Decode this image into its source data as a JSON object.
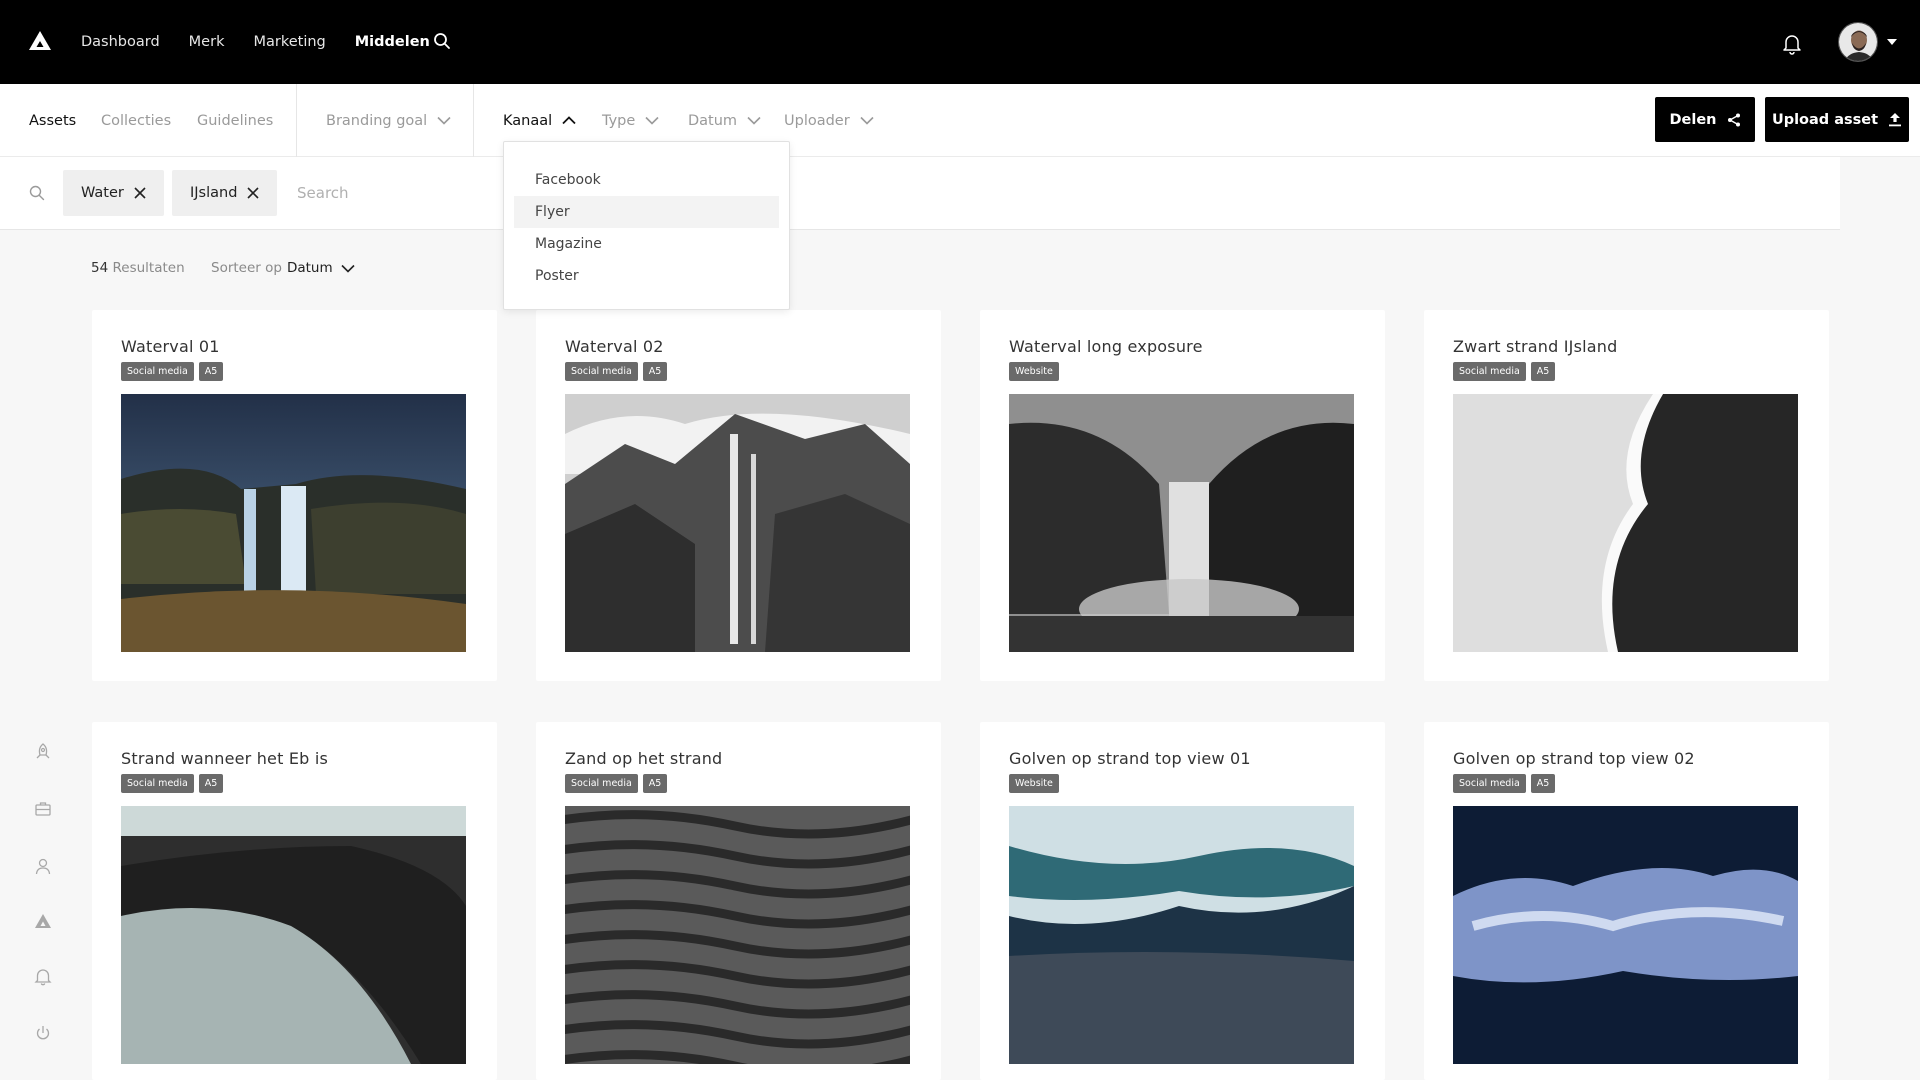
{
  "nav": {
    "items": [
      {
        "label": "Dashboard",
        "active": false
      },
      {
        "label": "Merk",
        "active": false
      },
      {
        "label": "Marketing",
        "active": false
      },
      {
        "label": "Middelen",
        "active": true
      }
    ]
  },
  "toolbar": {
    "tabs": [
      "Assets",
      "Collecties",
      "Guidelines"
    ],
    "filters": {
      "branding_goal": "Branding goal",
      "kanaal": "Kanaal",
      "type": "Type",
      "datum": "Datum",
      "uploader": "Uploader"
    },
    "share_label": "Delen",
    "upload_label": "Upload asset"
  },
  "search": {
    "chips": [
      "Water",
      "IJsland"
    ],
    "placeholder": "Search"
  },
  "kanaal_dropdown": {
    "options": [
      "Facebook",
      "Flyer",
      "Magazine",
      "Poster"
    ],
    "hovered": "Flyer"
  },
  "results": {
    "count": "54",
    "label": "Resultaten",
    "sort_prefix": "Sorteer op",
    "sort_value": "Datum"
  },
  "cards": [
    {
      "title": "Waterval 01",
      "tags": [
        "Social media",
        "A5"
      ]
    },
    {
      "title": "Waterval 02",
      "tags": [
        "Social media",
        "A5"
      ]
    },
    {
      "title": "Waterval long exposure",
      "tags": [
        "Website"
      ]
    },
    {
      "title": "Zwart strand IJsland",
      "tags": [
        "Social media",
        "A5"
      ]
    },
    {
      "title": "Strand wanneer het Eb is",
      "tags": [
        "Social media",
        "A5"
      ]
    },
    {
      "title": "Zand op het strand",
      "tags": [
        "Social media",
        "A5"
      ]
    },
    {
      "title": "Golven op strand top view 01",
      "tags": [
        "Website"
      ]
    },
    {
      "title": "Golven op strand top view 02",
      "tags": [
        "Social media",
        "A5"
      ]
    }
  ],
  "colors": {
    "nav_bg": "#000000",
    "accent": "#000000",
    "tag_bg": "#6a6a6a"
  }
}
